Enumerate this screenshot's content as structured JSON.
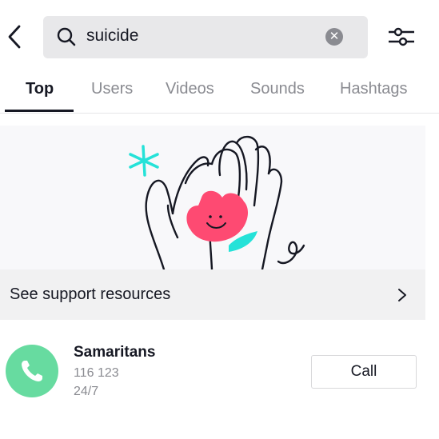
{
  "header": {
    "back_icon": "chevron-left-icon",
    "search": {
      "icon": "search-icon",
      "value": "suicide",
      "clear_icon": "clear-x-icon"
    },
    "filter_icon": "sliders-icon"
  },
  "tabs": [
    {
      "label": "Top",
      "active": true
    },
    {
      "label": "Users",
      "active": false
    },
    {
      "label": "Videos",
      "active": false
    },
    {
      "label": "Sounds",
      "active": false
    },
    {
      "label": "Hashtags",
      "active": false
    }
  ],
  "banner": {
    "illustration": "hands-holding-smiling-flower",
    "link_label": "See support resources",
    "chevron_icon": "chevron-right-icon"
  },
  "hotline": {
    "icon": "phone-icon",
    "name": "Samaritans",
    "number": "116 123",
    "hours": "24/7",
    "button_label": "Call"
  },
  "colors": {
    "phone_green": "#67dba0",
    "flower_pink": "#fe4a72",
    "accent_teal": "#25e2d8",
    "text_primary": "#161823",
    "text_secondary": "#8a8b91"
  }
}
